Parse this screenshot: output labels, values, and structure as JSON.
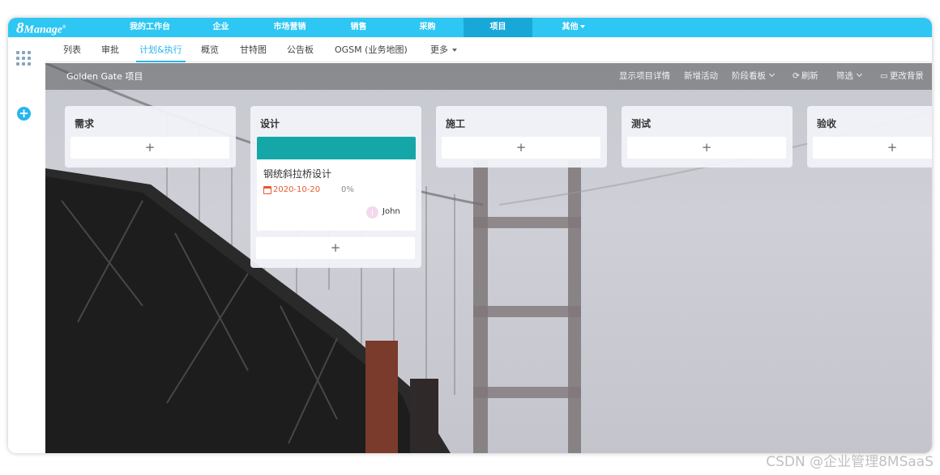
{
  "app": {
    "logo_number": "8",
    "logo_text": "Manage",
    "logo_mark": "®"
  },
  "top_nav": {
    "items": [
      {
        "label": "我的工作台"
      },
      {
        "label": "企业"
      },
      {
        "label": "市场营销"
      },
      {
        "label": "销售"
      },
      {
        "label": "采购"
      },
      {
        "label": "项目"
      },
      {
        "label": "其他"
      }
    ],
    "active": "项目"
  },
  "sub_nav": {
    "tabs": [
      {
        "label": "列表"
      },
      {
        "label": "审批"
      },
      {
        "label": "计划&执行"
      },
      {
        "label": "概览"
      },
      {
        "label": "甘特图"
      },
      {
        "label": "公告板"
      },
      {
        "label": "OGSM (业务地图)"
      },
      {
        "label": "更多"
      }
    ],
    "active": "计划&执行"
  },
  "project": {
    "title": "Golden Gate 项目",
    "actions": {
      "details": "显示项目详情",
      "new_activity": "新增活动",
      "stage_board": "阶段看板",
      "refresh": "刷新",
      "filter": "筛选",
      "change_bg": "更改背景"
    }
  },
  "board": {
    "add_symbol": "+",
    "columns": [
      {
        "title": "需求"
      },
      {
        "title": "设计"
      },
      {
        "title": "施工"
      },
      {
        "title": "测试"
      },
      {
        "title": "验收"
      }
    ],
    "card": {
      "title": "钢统斜拉桥设计",
      "date": "2020-10-20",
      "progress": "0%",
      "user": "John",
      "user_initial": "J",
      "color": "#15a7a7"
    }
  },
  "watermark": "CSDN @企业管理8MSaaS",
  "colors": {
    "nav": "#2ec6f2",
    "accent": "#27b6ee",
    "card_head": "#15a7a7"
  },
  "icons": [
    "grid-icon",
    "plus-circle-icon",
    "refresh-icon",
    "background-icon",
    "calendar-icon"
  ]
}
